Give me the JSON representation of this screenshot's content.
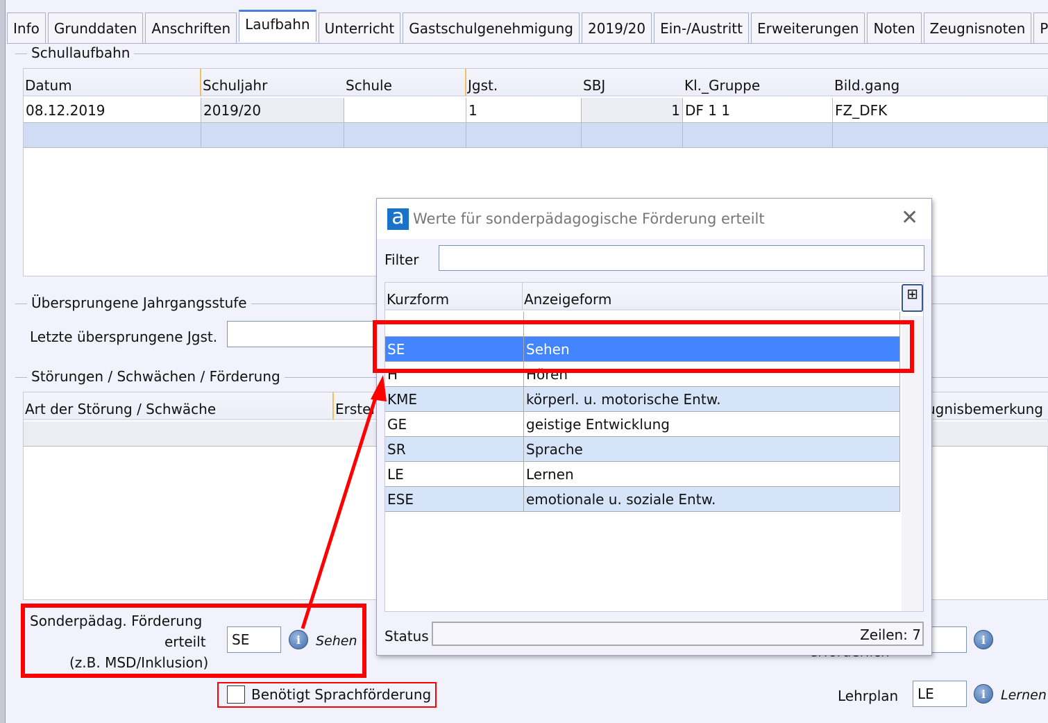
{
  "tabs": [
    "Info",
    "Grunddaten",
    "Anschriften",
    "Laufbahn",
    "Unterricht",
    "Gastschulgenehmigung",
    "2019/20",
    "Ein-/Austritt",
    "Erweiterungen",
    "Noten",
    "Zeugnisnoten",
    "Person"
  ],
  "active_tab": "Laufbahn",
  "schullaufbahn": {
    "legend": "Schullaufbahn",
    "columns": [
      "Datum",
      "Schuljahr",
      "Schule",
      "Jgst.",
      "SBJ",
      "Kl._Gruppe",
      "Bild.gang"
    ],
    "rows": [
      [
        "08.12.2019",
        "2019/20",
        "",
        "1",
        "1",
        "DF 1 1",
        "FZ_DFK"
      ]
    ]
  },
  "uebersprungen": {
    "legend": "Übersprungene Jahrgangsstufe",
    "label": "Letzte übersprungene Jgst.",
    "value": ""
  },
  "stoerungen": {
    "legend": "Störungen / Schwächen / Förderung",
    "columns": [
      "Art der Störung / Schwäche",
      "Erstel",
      "ugnisbemerkung"
    ]
  },
  "foerderung": {
    "label1": "Sonderpädag. Förderung",
    "label2": "erteilt",
    "label3": "(z.B. MSD/Inklusion)",
    "value": "SE",
    "display": "Sehen"
  },
  "sprachfoerderung": {
    "label": "Benötigt Sprachförderung",
    "checked": false
  },
  "erforderlich": {
    "label": "erforderlich",
    "value": ""
  },
  "lehrplan": {
    "label": "Lehrplan",
    "value": "LE",
    "display": "Lernen"
  },
  "dialog": {
    "title": "Werte für sonderpädagogische Förderung erteilt",
    "logo": "a",
    "filter_label": "Filter",
    "filter_value": "",
    "columns": [
      "Kurzform",
      "Anzeigeform"
    ],
    "rows": [
      [
        "",
        ""
      ],
      [
        "SE",
        "Sehen"
      ],
      [
        "H",
        "Hören"
      ],
      [
        "KME",
        "körperl. u. motorische Entw."
      ],
      [
        "GE",
        "geistige Entwicklung"
      ],
      [
        "SR",
        "Sprache"
      ],
      [
        "LE",
        "Lernen"
      ],
      [
        "ESE",
        "emotionale u. soziale Entw."
      ]
    ],
    "selected": "SE",
    "status_label": "Status",
    "status_value": "Zeilen: 7"
  },
  "colors": {
    "selection": "#4285ff",
    "alt_row": "#d6e4fa",
    "annotation": "#ff0000",
    "background": "#f2f2fc"
  }
}
